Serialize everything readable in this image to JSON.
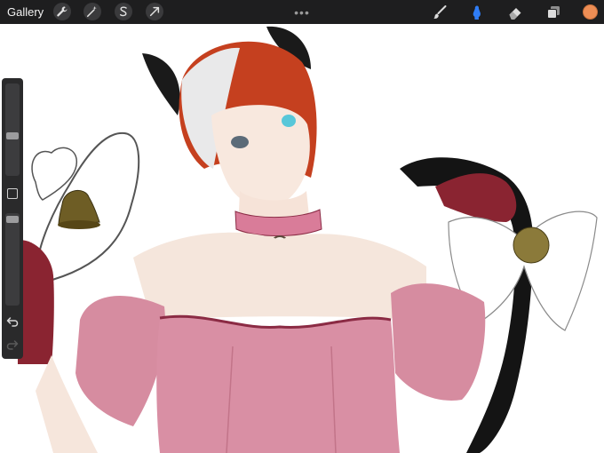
{
  "topbar": {
    "gallery_label": "Gallery",
    "left_tools": [
      {
        "name": "adjustments",
        "icon": "wrench-icon"
      },
      {
        "name": "adjust-magic",
        "icon": "magic-wand-icon"
      },
      {
        "name": "selection",
        "icon": "selection-s-icon"
      },
      {
        "name": "transform",
        "icon": "arrow-cursor-icon"
      }
    ],
    "more_label": "•••",
    "right_tools": [
      {
        "name": "brush",
        "icon": "brush-icon",
        "active": false
      },
      {
        "name": "smudge",
        "icon": "smudge-icon",
        "active": true
      },
      {
        "name": "eraser",
        "icon": "eraser-icon",
        "active": false
      },
      {
        "name": "layers",
        "icon": "layers-icon",
        "active": false
      }
    ],
    "current_color": "#ee8e55",
    "active_tool_color": "#2f7df6"
  },
  "sidebar": {
    "brush_size_level": 0.43,
    "opacity_level": 0.98
  }
}
